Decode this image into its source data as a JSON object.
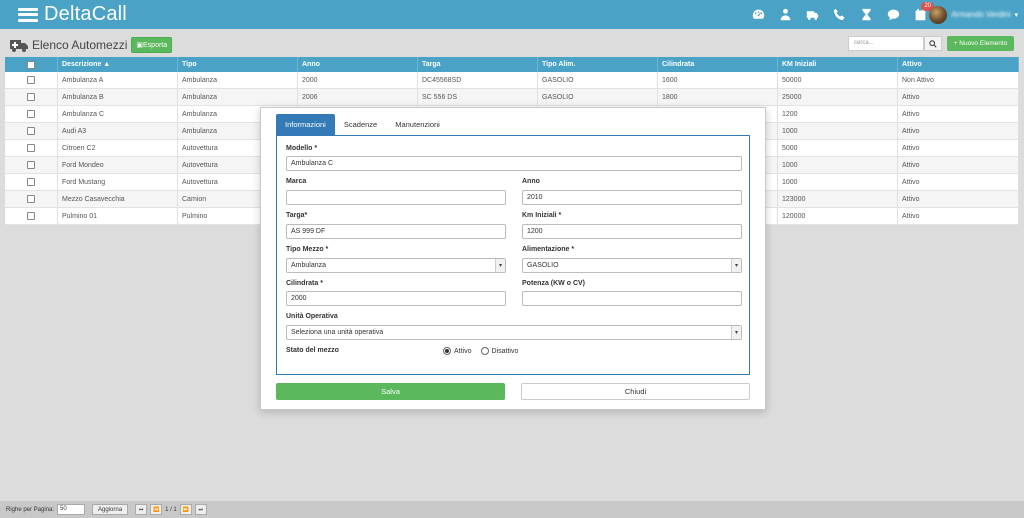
{
  "app": {
    "title": "DeltaCall",
    "notification_count": "20",
    "user_name": "Armando Verdini"
  },
  "page": {
    "title": "Elenco Automezzi",
    "export_label": "Esporta",
    "search_placeholder": "cerca...",
    "new_label": "+ Nuovo Elemento"
  },
  "table": {
    "headers": [
      "Descrizione ▲",
      "Tipo",
      "Anno",
      "Targa",
      "Tipo Alim.",
      "Cilindrata",
      "KM Iniziali",
      "Attivo"
    ],
    "rows": [
      [
        "Ambulanza A",
        "Ambulanza",
        "2000",
        "DC45568SD",
        "GASOLIO",
        "1600",
        "50000",
        "Non Attivo"
      ],
      [
        "Ambulanza B",
        "Ambulanza",
        "2006",
        "SC 556 DS",
        "GASOLIO",
        "1800",
        "25000",
        "Attivo"
      ],
      [
        "Ambulanza C",
        "Ambulanza",
        "",
        "",
        "",
        "",
        "1200",
        "Attivo"
      ],
      [
        "Audi A3",
        "Ambulanza",
        "",
        "",
        "",
        "",
        "1000",
        "Attivo"
      ],
      [
        "Citroen C2",
        "Autovettura",
        "",
        "",
        "",
        "",
        "5000",
        "Attivo"
      ],
      [
        "Ford Mondeo",
        "Autovettura",
        "",
        "",
        "",
        "",
        "1000",
        "Attivo"
      ],
      [
        "Ford Mustang",
        "Autovettura",
        "",
        "",
        "",
        "",
        "1000",
        "Attivo"
      ],
      [
        "Mezzo Casavecchia",
        "Camion",
        "",
        "",
        "",
        "",
        "123000",
        "Attivo"
      ],
      [
        "Pulmino 01",
        "Pulmino",
        "",
        "",
        "",
        "",
        "120000",
        "Attivo"
      ]
    ]
  },
  "modal": {
    "tabs": [
      "Informazioni",
      "Scadenze",
      "Manutenzioni"
    ],
    "fields": {
      "modello_label": "Modello *",
      "modello_value": "Ambulanza C",
      "marca_label": "Marca",
      "marca_value": "",
      "anno_label": "Anno",
      "anno_value": "2010",
      "targa_label": "Targa*",
      "targa_value": "AS 999 DF",
      "km_label": "Km Iniziali *",
      "km_value": "1200",
      "tipo_label": "Tipo Mezzo *",
      "tipo_value": "Ambulanza",
      "alim_label": "Alimentazione *",
      "alim_value": "GASOLIO",
      "cil_label": "Cilindrata *",
      "cil_value": "2000",
      "potenza_label": "Potenza (KW o CV)",
      "potenza_value": "",
      "unita_label": "Unità Operativa",
      "unita_value": "Seleziona una unità operativa",
      "stato_label": "Stato del mezzo",
      "stato_on": "Attivo",
      "stato_off": "Disattivo"
    },
    "save_label": "Salva",
    "close_label": "Chiudi"
  },
  "footer": {
    "rows_label": "Righe per Pagina:",
    "rows_value": "50",
    "refresh_label": "Aggiorna",
    "page_info": "1 / 1"
  }
}
